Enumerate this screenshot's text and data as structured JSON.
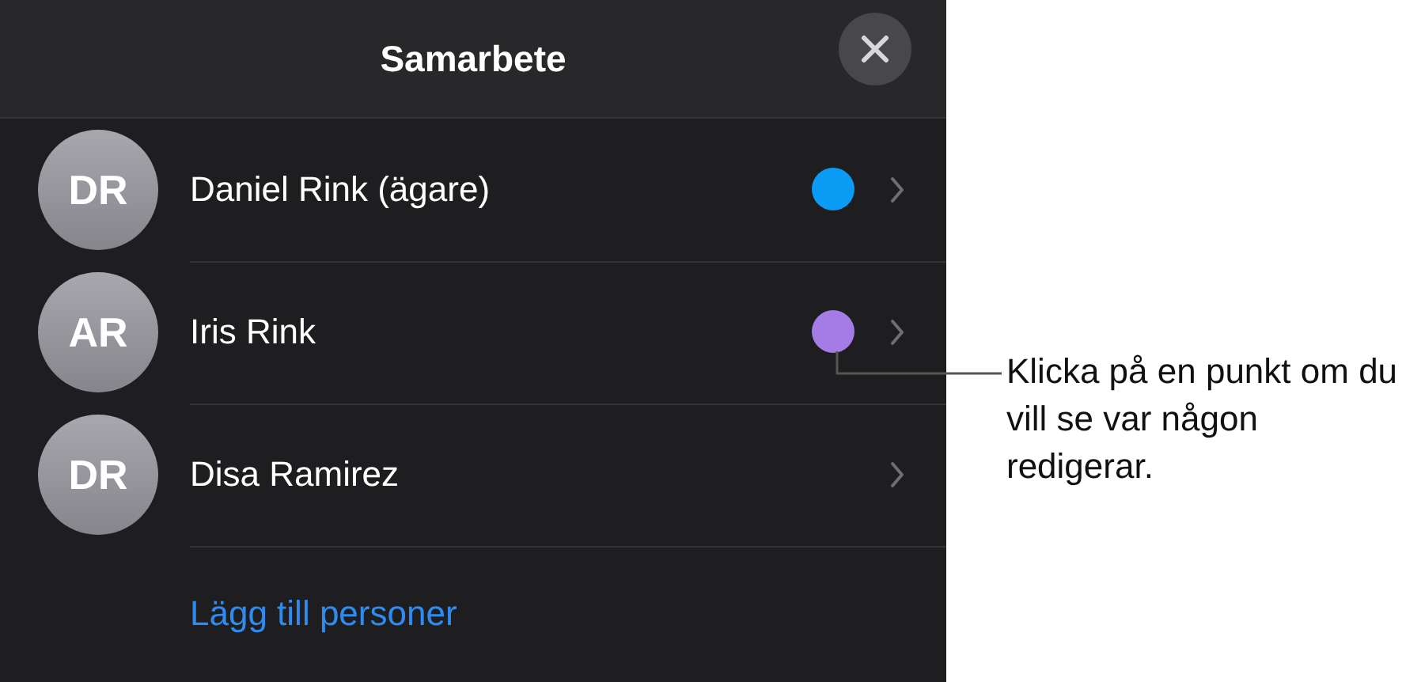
{
  "panel": {
    "title": "Samarbete",
    "people": [
      {
        "initials": "DR",
        "name": "Daniel Rink (ägare)",
        "color": "#0a9cf5"
      },
      {
        "initials": "AR",
        "name": "Iris Rink",
        "color": "#a57be6"
      },
      {
        "initials": "DR",
        "name": "Disa Ramirez"
      }
    ],
    "add_link": "Lägg till personer"
  },
  "callout": {
    "text": "Klicka på en punkt om du vill se var någon redigerar."
  }
}
